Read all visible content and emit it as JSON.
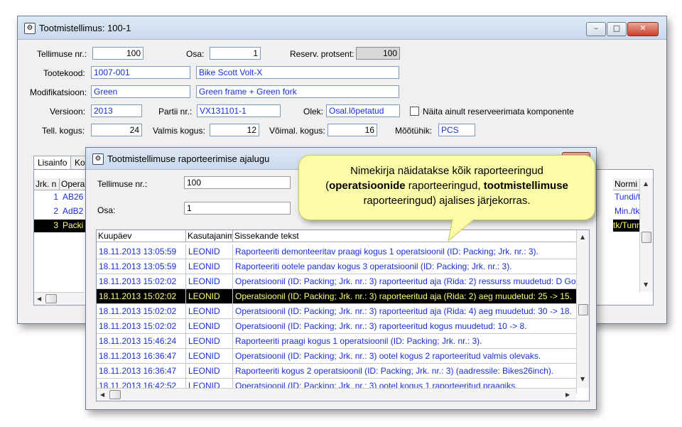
{
  "main_window": {
    "title": "Tootmistellimus: 100-1",
    "fields": {
      "order_no_label": "Tellimuse nr.:",
      "order_no": "100",
      "part_label": "Osa:",
      "part": "1",
      "reserve_label": "Reserv. protsent:",
      "reserve": "100",
      "product_code_label": "Tootekood:",
      "product_code": "1007-001",
      "product_name": "Bike Scott Volt-X",
      "modification_label": "Modifikatsioon:",
      "modification": "Green",
      "modification_desc": "Green frame + Green fork",
      "version_label": "Versioon:",
      "version": "2013",
      "batch_label": "Partii nr.:",
      "batch": "VX131101-1",
      "state_label": "Olek:",
      "state": "Osal.lõpetatud",
      "checkbox_label": "Näita ainult reserveerimata komponente",
      "total_qty_label": "Tell. kogus:",
      "total_qty": "24",
      "done_qty_label": "Valmis kogus:",
      "done_qty": "12",
      "possible_qty_label": "Võimal. kogus:",
      "possible_qty": "16",
      "unit_label": "Mõõtühik:",
      "unit": "PCS"
    },
    "tabs": [
      "Lisainfo",
      "Ko"
    ],
    "grid": {
      "headers": [
        "Jrk. n",
        "Opera",
        "Normi üh"
      ],
      "rows": [
        {
          "no": "1",
          "op": "AB26",
          "unit": "Tundi/tk"
        },
        {
          "no": "2",
          "op": "AdB2",
          "unit": "Min./tk"
        },
        {
          "no": "3",
          "op": "Packi",
          "unit": "tk/Tunni"
        }
      ]
    }
  },
  "history_window": {
    "title": "Tootmistellimuse raporteerimise ajalugu",
    "order_no_label": "Tellimuse nr.:",
    "order_no": "100",
    "part_label": "Osa:",
    "part": "1",
    "columns": [
      "Kuupäev",
      "Kasutajanim",
      "Sissekande tekst"
    ],
    "rows": [
      {
        "date": "18.11.2013 13:05:59",
        "user": "LEONID",
        "text": "Raporteeriti demonteeritav praagi kogus 1 operatsioonil (ID: Packing; Jrk. nr.: 3).",
        "selected": false
      },
      {
        "date": "18.11.2013 13:05:59",
        "user": "LEONID",
        "text": "Raporteeriti ootele pandav kogus 3 operatsioonil (ID: Packing; Jrk. nr.: 3).",
        "selected": false
      },
      {
        "date": "18.11.2013 15:02:02",
        "user": "LEONID",
        "text": "Operatsioonil (ID: Packing; Jrk. nr.: 3) raporteeritud aja (Rida: 2) ressurss muudetud: D Golov",
        "selected": false
      },
      {
        "date": "18.11.2013 15:02:02",
        "user": "LEONID",
        "text": "Operatsioonil (ID: Packing; Jrk. nr.: 3) raporteeritud aja (Rida: 2) aeg muudetud: 25 -> 15.",
        "selected": true
      },
      {
        "date": "18.11.2013 15:02:02",
        "user": "LEONID",
        "text": "Operatsioonil (ID: Packing; Jrk. nr.: 3) raporteeritud aja (Rida: 4) aeg muudetud: 30 -> 18.",
        "selected": false
      },
      {
        "date": "18.11.2013 15:02:02",
        "user": "LEONID",
        "text": "Operatsioonil (ID: Packing; Jrk. nr.: 3) raporteeritud kogus muudetud: 10 -> 8.",
        "selected": false
      },
      {
        "date": "18.11.2013 15:46:24",
        "user": "LEONID",
        "text": "Raporteeriti praagi kogus 1 operatsioonil (ID: Packing; Jrk. nr.: 3).",
        "selected": false
      },
      {
        "date": "18.11.2013 16:36:47",
        "user": "LEONID",
        "text": "Operatsioonil (ID: Packing; Jrk. nr.: 3) ootel kogus 2 raporteeritud valmis olevaks.",
        "selected": false
      },
      {
        "date": "18.11.2013 16:36:47",
        "user": "LEONID",
        "text": "Raporteeriti kogus 2 operatsioonil (ID: Packing; Jrk. nr.: 3) (aadressile: Bikes26inch).",
        "selected": false
      },
      {
        "date": "18.11.2013 16:42:52",
        "user": "LEONID",
        "text": "Operatsioonil (ID: Packing; Jrk. nr.: 3) ootel kogus 1 raporteeritud praagiks.",
        "selected": false
      }
    ]
  },
  "callout": {
    "line1": "Nimekirja näidatakse kõik raporteeringud",
    "line2_pre": "(",
    "line2_bold1": "operatsioonide",
    "line2_mid": " raporteeringud, ",
    "line2_bold2": "tootmistellimuse",
    "line3": "raporteeringud) ajalises järjekorras."
  },
  "colors": {
    "link_text": "#1a2fd6",
    "selected_bg": "#000000",
    "selected_text": "#ffff7a",
    "callout_bg": "#fbfba8"
  }
}
